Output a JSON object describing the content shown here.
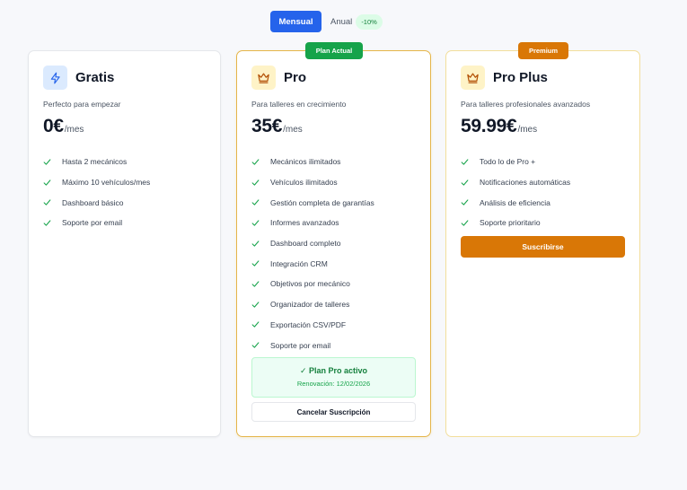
{
  "billing_toggle": {
    "monthly": "Mensual",
    "annual": "Anual",
    "discount": "-10%"
  },
  "plans": [
    {
      "name": "Gratis",
      "description": "Perfecto para empezar",
      "price": "0€",
      "period": "/mes",
      "icon": "lightning-icon",
      "features": [
        "Hasta 2 mecánicos",
        "Máximo 10 vehículos/mes",
        "Dashboard básico",
        "Soporte por email"
      ]
    },
    {
      "name": "Pro",
      "badge": "Plan Actual",
      "description": "Para talleres en crecimiento",
      "price": "35€",
      "period": "/mes",
      "icon": "crown-icon",
      "features": [
        "Mecánicos ilimitados",
        "Vehículos ilimitados",
        "Gestión completa de garantías",
        "Informes avanzados",
        "Dashboard completo",
        "Integración CRM",
        "Objetivos por mecánico",
        "Organizador de talleres",
        "Exportación CSV/PDF",
        "Soporte por email"
      ],
      "status_title": "✓ Plan Pro activo",
      "status_renewal": "Renovación: 12/02/2026",
      "cancel_label": "Cancelar Suscripción"
    },
    {
      "name": "Pro Plus",
      "badge": "Premium",
      "description": "Para talleres profesionales avanzados",
      "price": "59.99€",
      "period": "/mes",
      "icon": "crown-icon",
      "features": [
        "Todo lo de Pro +",
        "Notificaciones automáticas",
        "Análisis de eficiencia",
        "Soporte prioritario"
      ],
      "subscribe_label": "Suscribirse"
    }
  ],
  "colors": {
    "primary": "#2563eb",
    "success": "#16a34a",
    "premium": "#d97706",
    "check": "#16a34a",
    "crown": "#b45309",
    "lightning": "#2563eb"
  }
}
